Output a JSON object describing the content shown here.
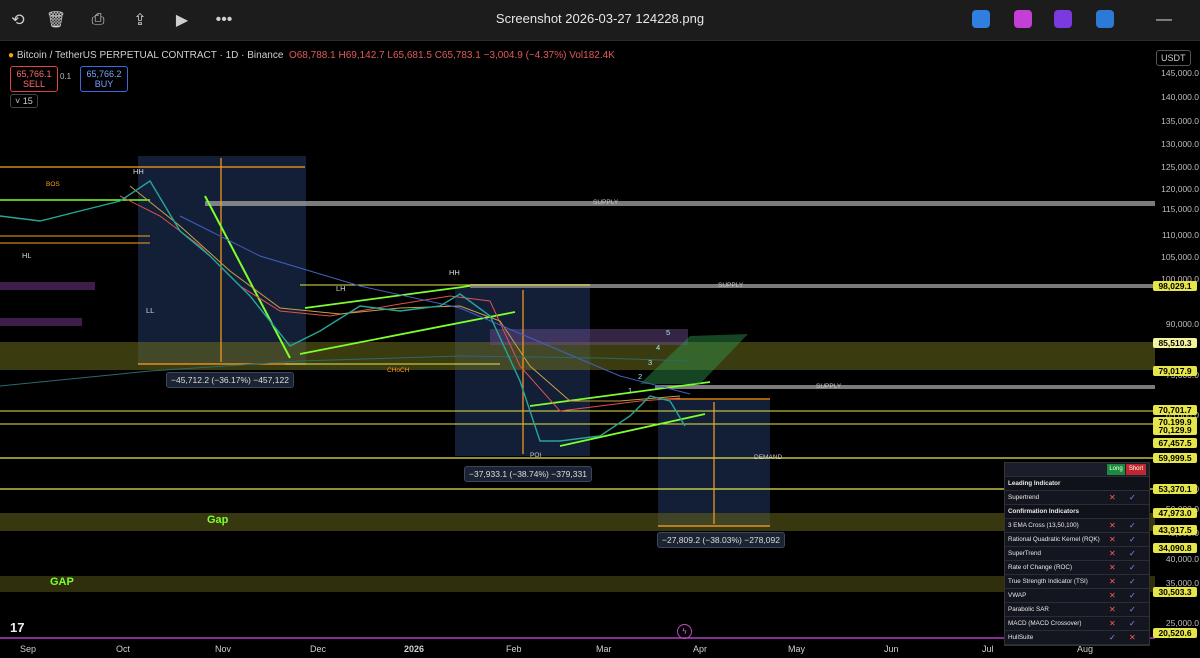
{
  "viewer": {
    "title": "Screenshot 2026-03-27 124228.png",
    "icons": [
      "rotate-icon",
      "delete-icon",
      "print-icon",
      "share-icon",
      "slideshow-icon",
      "more-icon"
    ],
    "more_label": "•••",
    "right_icons": [
      "edit-app-icon",
      "copilot-app-icon",
      "clipchamp-app-icon",
      "cloud-app-icon"
    ],
    "minimize_label": "—"
  },
  "header": {
    "symbol": "Bitcoin / TetherUS PERPETUAL CONTRACT · 1D · Binance",
    "o": "O68,788.1",
    "h": "H69,142.7",
    "l": "L65,681.5",
    "c": "C65,783.1",
    "change": "−3,004.9 (−4.37%)",
    "vol": "Vol182.4K",
    "sell_price": "65,766.1",
    "sell_label": "SELL",
    "spread": "0.1",
    "buy_price": "65,766.2",
    "buy_label": "BUY",
    "interval": "15",
    "currency": "USDT"
  },
  "price_axis": [
    "145,000.0",
    "140,000.0",
    "135,000.0",
    "130,000.0",
    "125,000.0",
    "120,000.0",
    "115,000.0",
    "110,000.0",
    "105,000.0",
    "100,000.0",
    "90,000.0",
    "75,000.0",
    "65,000.0",
    "55,000.0",
    "50,000.0",
    "45,000.0",
    "40,000.0",
    "35,000.0",
    "25,000.0"
  ],
  "price_tags": [
    {
      "text": "98,029.1",
      "color": "#e6e64a"
    },
    {
      "text": "85,510.3",
      "color": "#f4f4a0"
    },
    {
      "text": "79,017.9",
      "color": "#e6e64a"
    },
    {
      "text": "70,701.7",
      "color": "#e6e64a"
    },
    {
      "text": "70,199.9",
      "color": "#e6e64a"
    },
    {
      "text": "70,129.9",
      "color": "#e6e64a"
    },
    {
      "text": "67,457.5",
      "color": "#e6e64a"
    },
    {
      "text": "59,999.5",
      "color": "#e6e64a"
    },
    {
      "text": "53,370.1",
      "color": "#e6e64a"
    },
    {
      "text": "47,973.0",
      "color": "#e6e64a"
    },
    {
      "text": "43,917.5",
      "color": "#e6e64a"
    },
    {
      "text": "34,090.8",
      "color": "#e6e64a"
    },
    {
      "text": "30,503.3",
      "color": "#e6e64a"
    },
    {
      "text": "20,520.6",
      "color": "#e6e64a"
    }
  ],
  "time_axis": [
    "Sep",
    "Oct",
    "Nov",
    "Dec",
    "2026",
    "Feb",
    "Mar",
    "Apr",
    "May",
    "Jun",
    "Jul",
    "Aug"
  ],
  "labels": {
    "supply1": "SUPPLY",
    "supply2": "SUPPLY",
    "supply3": "SUPPLY",
    "demand": "DEMAND",
    "hh1": "HH",
    "hh2": "HH",
    "hl": "HL",
    "ll1": "LL",
    "ll2": "LL",
    "lh": "LH",
    "gap1": "Gap",
    "gap2": "GAP",
    "wave1": "1",
    "wave2": "2",
    "wave3": "3",
    "wave4": "4",
    "wave5": "5",
    "bos": "BOS",
    "choch": "CHoCH",
    "poi": "POI"
  },
  "measures": {
    "m1": "−45,712.2 (−36.17%) −457,122",
    "m2": "−37,933.1 (−38.74%) −379,331",
    "m3": "−27,809.2 (−38.03%) −278,092"
  },
  "indicator_table": {
    "long": "Long",
    "short": "Short",
    "rows": [
      {
        "label": "Leading Indicator",
        "section": true
      },
      {
        "label": "Supertrend",
        "x": "✕",
        "c": "✓"
      },
      {
        "label": "Confirmation Indicators",
        "section": true
      },
      {
        "label": "3 EMA Cross (13,50,100)",
        "x": "✕",
        "c": "✓"
      },
      {
        "label": "Rational Quadratic Kernel (RQK)",
        "x": "✕",
        "c": "✓"
      },
      {
        "label": "SuperTrend",
        "x": "✕",
        "c": "✓"
      },
      {
        "label": "Rate of Change (ROC)",
        "x": "✕",
        "c": "✓"
      },
      {
        "label": "True Strength Indicator (TSI)",
        "x": "✕",
        "c": "✓"
      },
      {
        "label": "VWAP",
        "x": "✕",
        "c": "✓"
      },
      {
        "label": "Parabolic SAR",
        "x": "✕",
        "c": "✓"
      },
      {
        "label": "MACD (MACD Crossover)",
        "x": "✕",
        "c": "✓"
      },
      {
        "label": "HullSuite",
        "x": "✓",
        "c": "✕"
      }
    ]
  },
  "colors": {
    "bull": "#26a69a",
    "bear": "#ef5350",
    "level": "#e6e64a",
    "zone": "#6b6b1e",
    "measure_box": "#1a2a4a",
    "accent_orange": "#ff9f1a",
    "trend_green": "#7dff2e"
  }
}
